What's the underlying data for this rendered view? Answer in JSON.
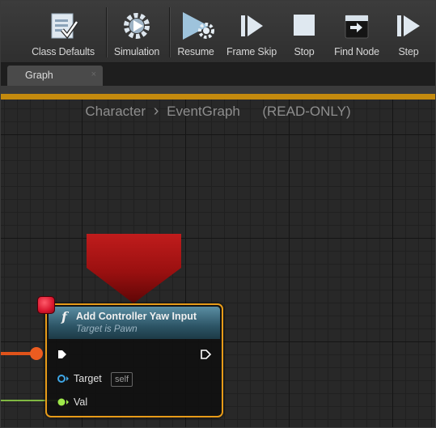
{
  "toolbar": {
    "buttons": [
      {
        "label": "Class Defaults",
        "icon": "class-defaults-icon"
      },
      {
        "label": "Simulation",
        "icon": "simulation-icon"
      },
      {
        "label": "Resume",
        "icon": "resume-icon"
      },
      {
        "label": "Frame Skip",
        "icon": "frame-skip-icon"
      },
      {
        "label": "Stop",
        "icon": "stop-icon"
      },
      {
        "label": "Find Node",
        "icon": "find-node-icon"
      },
      {
        "label": "Step",
        "icon": "step-icon"
      }
    ]
  },
  "tabs": [
    {
      "label": "Graph",
      "close": "×"
    }
  ],
  "breadcrumb": {
    "root": "Character",
    "separator": "›",
    "current": "EventGraph",
    "mode": "(READ-ONLY)"
  },
  "node": {
    "function_glyph": "f",
    "title": "Add Controller Yaw Input",
    "subtitle": "Target is Pawn",
    "pins": {
      "target_label": "Target",
      "target_default": "self",
      "val_label": "Val"
    }
  },
  "colors": {
    "toolbar_bg": "#333333",
    "graph_bg": "#282828",
    "accent_orange": "#c48a0e",
    "node_border": "#e79b19",
    "node_header": "#2d5566",
    "exec_wire": "#e0531a",
    "float_wire": "#9ee84a",
    "breakpoint_marker": "#d9162e",
    "debug_arrow": "#b01818"
  }
}
